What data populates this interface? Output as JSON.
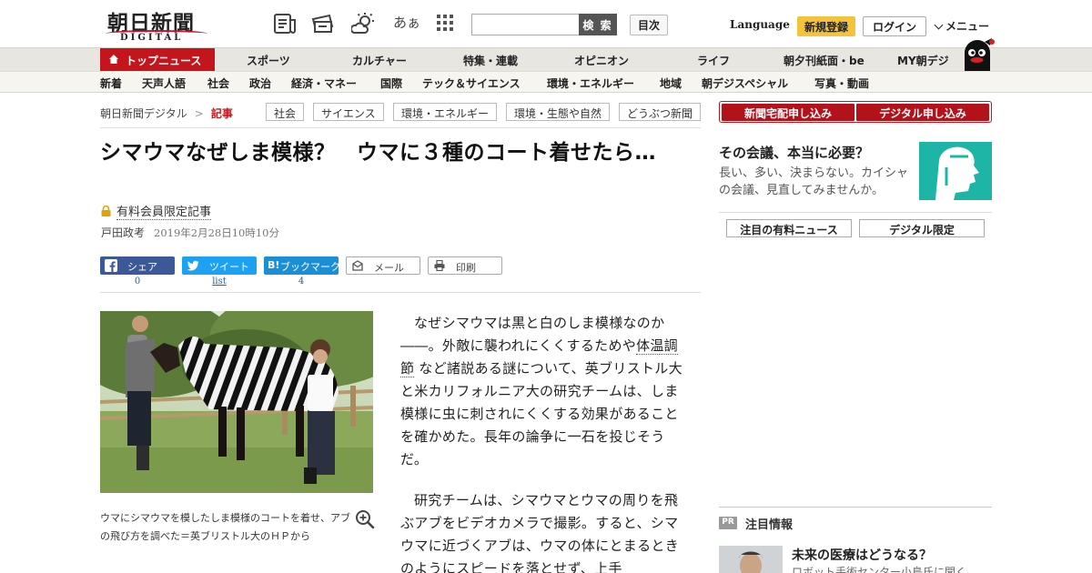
{
  "header": {
    "logo_ja": "朝日新聞",
    "logo_en": "DIGITAL",
    "moji_icon_text": "あぁ",
    "search_placeholder": "",
    "search_button": "検 索",
    "toc_button": "目次",
    "language": "Language",
    "register_button": "新規登録",
    "login_button": "ログイン",
    "menu_label": "メニュー",
    "icons": [
      "newspaper-icon",
      "coupon-icon",
      "weather-icon",
      "font-size-icon",
      "grid-icon"
    ]
  },
  "nav_main": {
    "top_label": "トップニュース",
    "items": [
      "スポーツ",
      "カルチャー",
      "特集・連載",
      "オピニオン",
      "ライフ",
      "朝夕刊紙面・be",
      "MY朝デジ"
    ]
  },
  "nav_sub": {
    "items": [
      "新着",
      "天声人語",
      "社会",
      "政治",
      "経済・マネー",
      "国際",
      "テック＆サイエンス",
      "環境・エネルギー",
      "地域",
      "朝デジスペシャル",
      "写真・動画"
    ]
  },
  "breadcrumb": {
    "home": "朝日新聞デジタル",
    "separator": ">",
    "current": "記事"
  },
  "tags": [
    "社会",
    "サイエンス",
    "環境・エネルギー",
    "環境・生態や自然",
    "どうぶつ新聞"
  ],
  "article": {
    "headline": "シマウマなぜしま模様？　ウマに３種のコート着せたら…",
    "members_only": "有料会員限定記事",
    "author": "戸田政考",
    "date": "2019年2月28日10時10分",
    "photo_caption": "ウマにシマウマを模したしま模様のコートを着せ、アブの飛び方を調べた＝英ブリストル大のＨＰから",
    "para1_a": "なぜシマウマは黒と白のしま模様なのか――。外敵に襲われにくくするためや",
    "para1_kw": "体温調節",
    "para1_b": "など諸説ある謎について、英ブリストル大と米カリフォルニア大の研究チームは、しま模様に虫に刺されにくくする効果があることを確かめた。長年の論争に一石を投じそうだ。",
    "para2": "研究チームは、シマウマとウマの周りを飛ぶアブをビデオカメラで撮影。すると、シマウマに近づくアブは、ウマの体にとまるときのようにスピードを落とせず、上手"
  },
  "share": {
    "facebook": "シェア",
    "twitter": "ツイート",
    "hatena_mark": "B!",
    "hatena": "ブックマーク",
    "mail": "メール",
    "print": "印刷",
    "facebook_count": "0",
    "twitter_count": "list",
    "hatena_count": "4"
  },
  "sidebar": {
    "subscribe_paper": "新聞宅配申し込み",
    "subscribe_digital": "デジタル申し込み",
    "ad_title": "その会議、本当に必要？",
    "ad_desc": "長い、多い、決まらない。カイシャの会議、見直してみませんか。",
    "tab_paid": "注目の有料ニュース",
    "tab_digital": "デジタル限定",
    "pr_badge": "PR",
    "pr_heading": "注目情報",
    "pr_title": "未来の医療はどうなる？",
    "pr_sub": "ロボット手術センター小島氏に聞く"
  },
  "colors": {
    "brand_red": "#c4151c",
    "register_yellow": "#f5c33b",
    "facebook": "#3b5998",
    "twitter": "#1da1f2",
    "hatena": "#1a8fd8",
    "ad_teal": "#1fb5a6"
  }
}
